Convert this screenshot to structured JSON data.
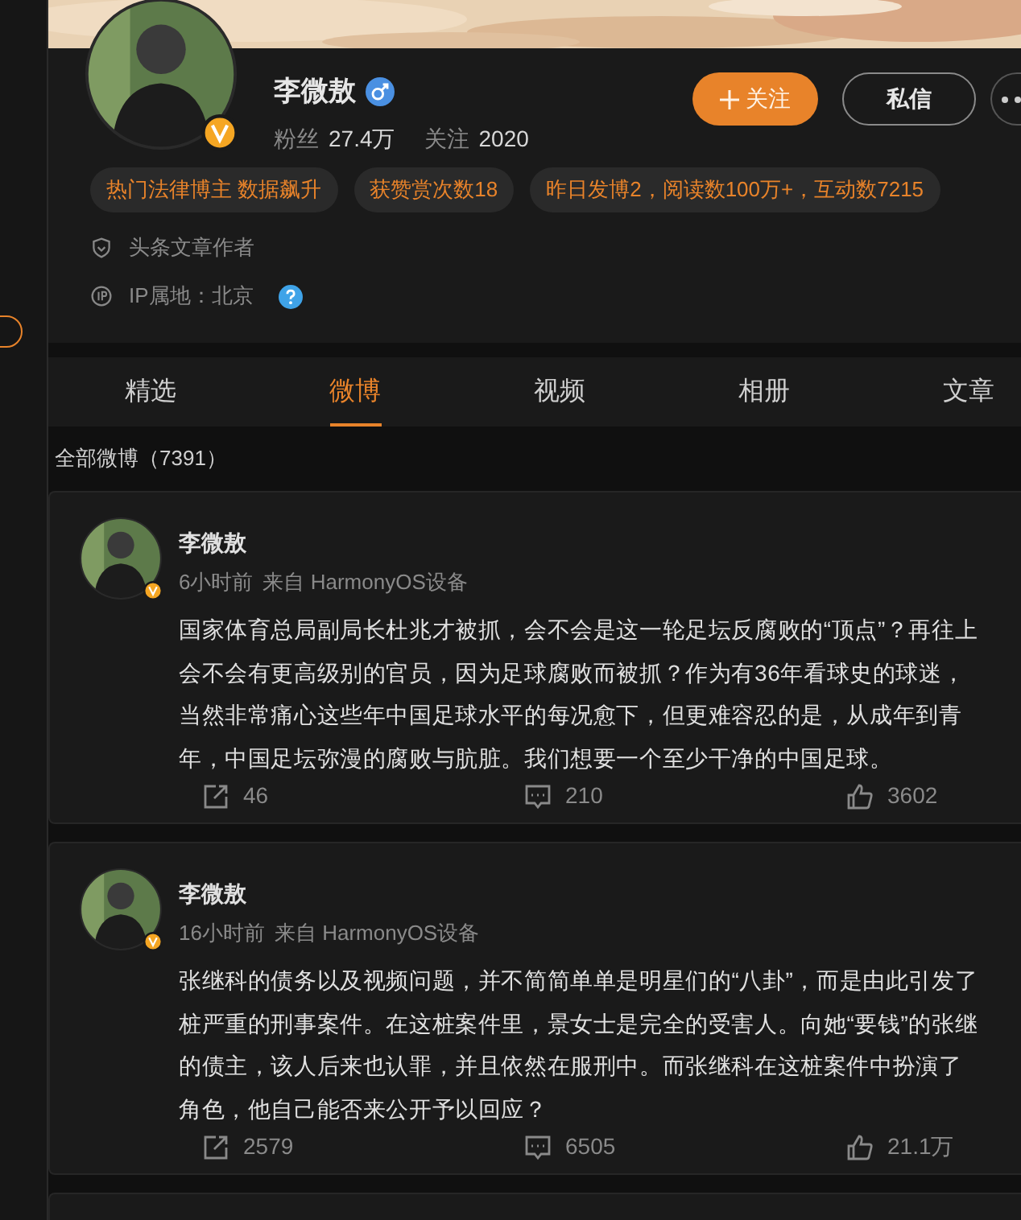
{
  "profile": {
    "name": "李微敖",
    "male": true,
    "verified": true,
    "fans_label": "粉丝",
    "fans": "27.4万",
    "following_label": "关注",
    "following": "2020",
    "follow_button": "关注",
    "message_button": "私信",
    "tags": [
      "热门法律博主 数据飙升",
      "获赞赏次数18",
      "昨日发博2，阅读数100万+，互动数7215"
    ],
    "info": [
      {
        "kind": "author",
        "text": "头条文章作者"
      },
      {
        "kind": "ip",
        "text": "IP属地：北京"
      }
    ]
  },
  "tabs": [
    {
      "label": "精选",
      "selected": false
    },
    {
      "label": "微博",
      "selected": true
    },
    {
      "label": "视频",
      "selected": false
    },
    {
      "label": "相册",
      "selected": false
    },
    {
      "label": "文章",
      "selected": false
    }
  ],
  "feed_title": "全部微博（7391）",
  "posts": [
    {
      "author": "李微敖",
      "verified": true,
      "time": "6小时前",
      "source": "来自 HarmonyOS设备",
      "lines": [
        "国家体育总局副局长杜兆才被抓，会不会是这一轮足坛反腐败的“顶点”？再往上",
        "会不会有更高级别的官员，因为足球腐败而被抓？作为有36年看球史的球迷，",
        "当然非常痛心这些年中国足球水平的每况愈下，但更难容忍的是，从成年到青",
        "年，中国足坛弥漫的腐败与肮脏。我们想要一个至少干净的中国足球。"
      ],
      "reposts": "46",
      "comments": "210",
      "likes": "3602"
    },
    {
      "author": "李微敖",
      "verified": true,
      "time": "16小时前",
      "source": "来自 HarmonyOS设备",
      "lines": [
        "张继科的债务以及视频问题，并不简简单单是明星们的“八卦”，而是由此引发了",
        "桩严重的刑事案件。在这桩案件里，景女士是完全的受害人。向她“要钱”的张继",
        "的债主，该人后来也认罪，并且依然在服刑中。而张继科在这桩案件中扮演了",
        "角色，他自己能否来公开予以回应？"
      ],
      "reposts": "2579",
      "comments": "6505",
      "likes": "21.1万"
    }
  ]
}
